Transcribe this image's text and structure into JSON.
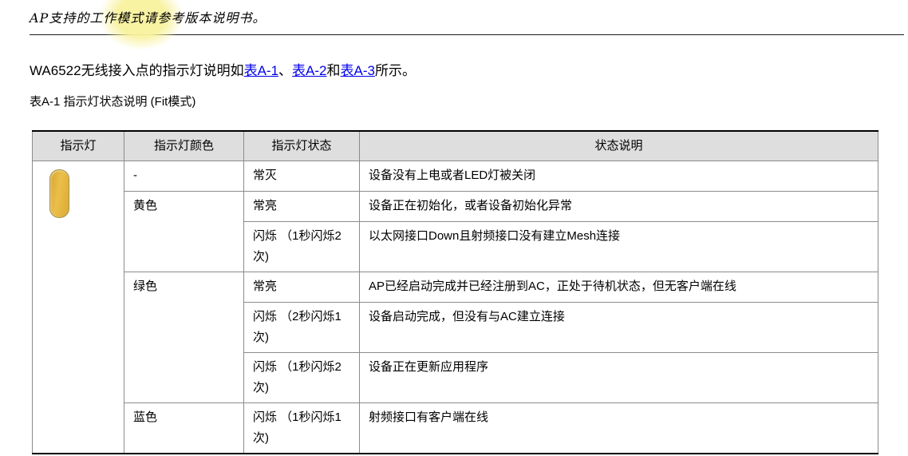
{
  "page": {
    "note_line": "AP支持的工作模式请参考版本说明书。",
    "intro": {
      "prefix": "WA6522无线接入点的指示灯说明如",
      "link1": "表A-1",
      "sep1": "、",
      "link2": "表A-2",
      "sep2": "和",
      "link3": "表A-3",
      "suffix": "所示。"
    },
    "table_caption": "表A-1 指示灯状态说明 (Fit模式)"
  },
  "colors": {
    "led_indicator": "#e2b136",
    "link_blue": "#0000ee",
    "header_background": "#dedede"
  },
  "table": {
    "headers": [
      "指示灯",
      "指示灯颜色",
      "指示灯状态",
      "状态说明"
    ],
    "led_icon": "yellow-led-pill",
    "rows": [
      {
        "color": "-",
        "state": "常灭",
        "desc": "设备没有上电或者LED灯被关闭"
      },
      {
        "color": "黄色",
        "state": "常亮",
        "desc": "设备正在初始化，或者设备初始化异常"
      },
      {
        "color": "",
        "state": "闪烁 （1秒闪烁2次)",
        "desc": "以太网接口Down且射频接口没有建立Mesh连接"
      },
      {
        "color": "绿色",
        "state": "常亮",
        "desc": "AP已经启动完成并已经注册到AC，正处于待机状态，但无客户端在线"
      },
      {
        "color": "",
        "state": "闪烁 （2秒闪烁1次)",
        "desc": "设备启动完成，但没有与AC建立连接"
      },
      {
        "color": "",
        "state": "闪烁 （1秒闪烁2次)",
        "desc": "设备正在更新应用程序"
      },
      {
        "color": "蓝色",
        "state": "闪烁 （1秒闪烁1次)",
        "desc": "射频接口有客户端在线"
      }
    ]
  }
}
